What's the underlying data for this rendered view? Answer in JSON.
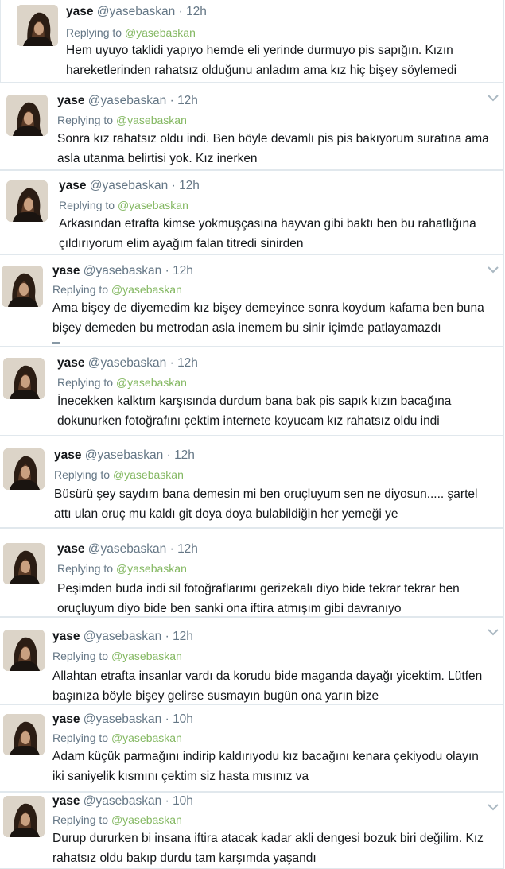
{
  "colors": {
    "accent": "#84b862",
    "text": "#14171a",
    "muted": "#657786",
    "border": "#e1e8ed"
  },
  "tweets": [
    {
      "name": "yase",
      "handle": "@yasebaskan",
      "sep": "·",
      "time": "12h",
      "replying_label": "Replying to",
      "replying_to": "@yasebaskan",
      "text": "Hem uyuyo taklidi yapıyo hemde eli yerinde durmuyo pis sapığın. Kızın\nhareketlerinden rahatsız olduğunu anladım ama kız hiç bişey söylemedi",
      "caret_icon": "none"
    },
    {
      "name": "yase",
      "handle": "@yasebaskan",
      "sep": "·",
      "time": "12h",
      "replying_label": "Replying to",
      "replying_to": "@yasebaskan",
      "text": "Sonra kız rahatsız oldu indi. Ben böyle devamlı pis pis bakıyorum suratına ama\nasla utanma belirtisi yok. Kız inerken",
      "caret_icon": "chevron-down-icon"
    },
    {
      "name": "yase",
      "handle": "@yasebaskan",
      "sep": "·",
      "time": "12h",
      "replying_label": "Replying to",
      "replying_to": "@yasebaskan",
      "text": "Arkasından etrafta kimse yokmuşçasına hayvan gibi baktı ben bu rahatlığına\nçıldırıyorum elim ayağım falan titredi sinirden",
      "caret_icon": "none"
    },
    {
      "name": "yase",
      "handle": "@yasebaskan",
      "sep": "·",
      "time": "12h",
      "replying_label": "Replying to",
      "replying_to": "@yasebaskan",
      "text": "Ama bişey de diyemedim kız bişey demeyince sonra koydum kafama ben buna\nbişey demeden bu metrodan asla inemem bu sinir içimde patlayamazdı",
      "caret_icon": "chevron-down-icon"
    },
    {
      "name": "yase",
      "handle": "@yasebaskan",
      "sep": "·",
      "time": "12h",
      "replying_label": "Replying to",
      "replying_to": "@yasebaskan",
      "text": "İnecekken kalktım karşısında durdum bana bak pis sapık kızın bacağına\ndokunurken fotoğrafını çektim internete koyucam kız rahatsız oldu indi",
      "caret_icon": "none"
    },
    {
      "name": "yase",
      "handle": "@yasebaskan",
      "sep": "·",
      "time": "12h",
      "replying_label": "Replying to",
      "replying_to": "@yasebaskan",
      "text": "Büsürü şey saydım bana demesin mi ben oruçluyum sen ne diyosun..... şartel\nattı ulan oruç mu kaldı git doya doya bulabildiğin her yemeği ye",
      "caret_icon": "none"
    },
    {
      "name": "yase",
      "handle": "@yasebaskan",
      "sep": "·",
      "time": "12h",
      "replying_label": "Replying to",
      "replying_to": "@yasebaskan",
      "text": "Peşimden buda indi sil fotoğraflarımı gerizekalı diyo bide tekrar tekrar ben\noruçluyum diyo bide ben sanki ona iftira atmışım gibi davranıyo",
      "caret_icon": "none"
    },
    {
      "name": "yase",
      "handle": "@yasebaskan",
      "sep": "·",
      "time": "12h",
      "replying_label": "Replying to",
      "replying_to": "@yasebaskan",
      "text": "Allahtan etrafta insanlar vardı da korudu bide maganda dayağı yicektim. Lütfen\nbaşınıza böyle bişey gelirse susmayın bugün ona yarın bize",
      "caret_icon": "chevron-down-icon"
    },
    {
      "name": "yase",
      "handle": "@yasebaskan",
      "sep": "·",
      "time": "10h",
      "replying_label": "Replying to",
      "replying_to": "@yasebaskan",
      "text": "Adam küçük parmağını indirip kaldırıyodu kız bacağını kenara çekiyodu olayın\niki saniyelik kısmını çektim siz hasta mısınız va",
      "caret_icon": "none"
    },
    {
      "name": "yase",
      "handle": "@yasebaskan",
      "sep": "·",
      "time": "10h",
      "replying_label": "Replying to",
      "replying_to": "@yasebaskan",
      "text": "Durup dururken bi insana iftira atacak kadar akli dengesi bozuk biri değilim. Kız\nrahatsız oldu bakıp durdu tam karşımda yaşandı",
      "caret_icon": "chevron-down-icon"
    }
  ]
}
